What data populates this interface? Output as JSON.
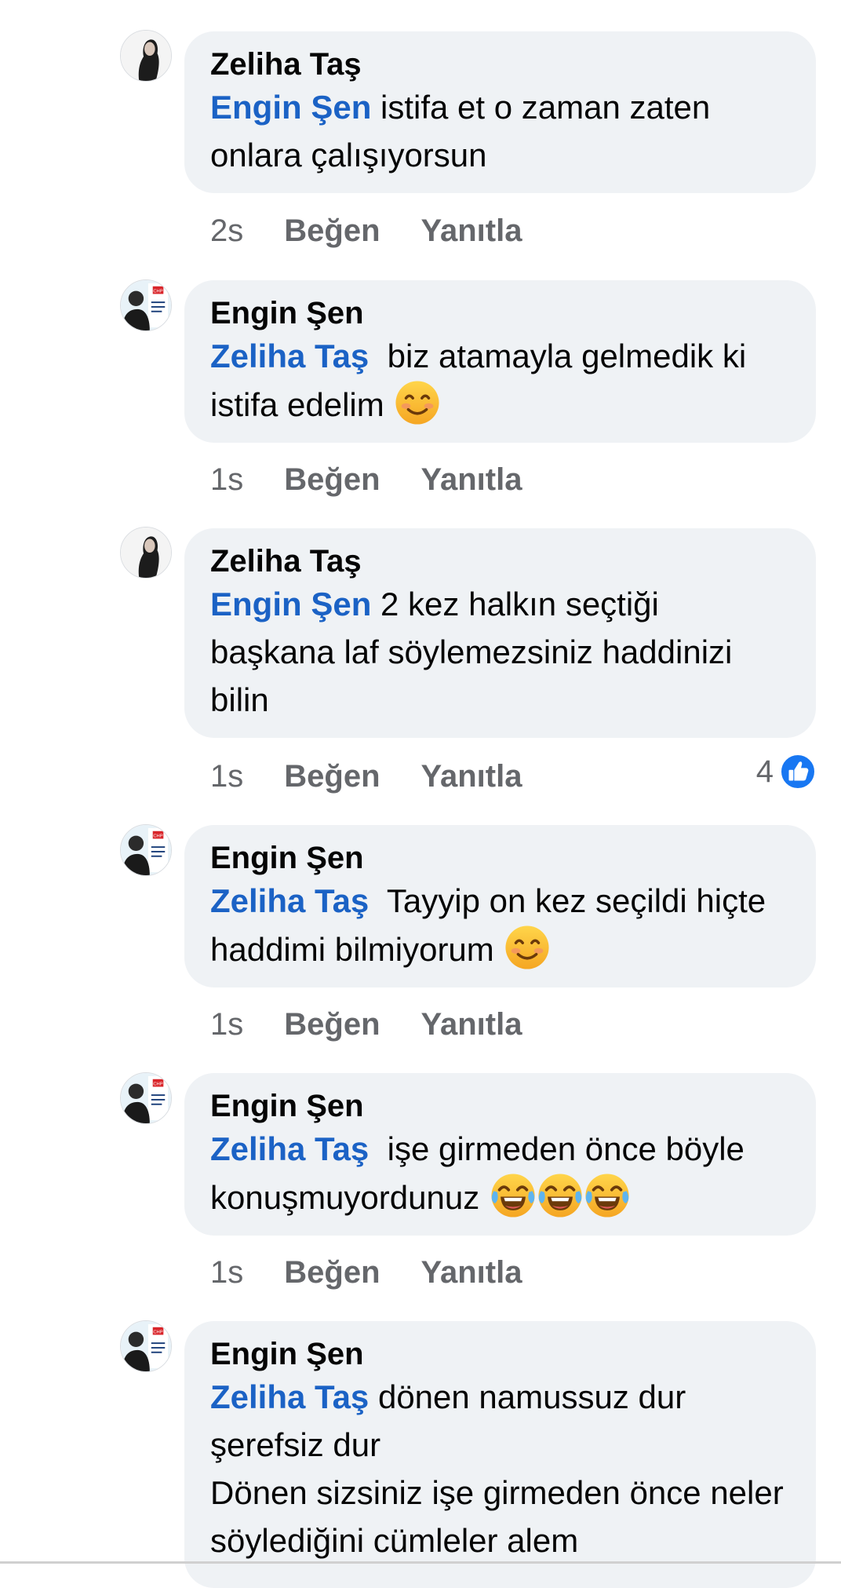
{
  "comments": [
    {
      "author": "Zeliha Taş",
      "mention": "Engin Şen",
      "text": " istifa et o zaman zaten onlara çalışıyorsun",
      "time": "2s",
      "like_label": "Beğen",
      "reply_label": "Yanıtla",
      "avatar_icon": "profile-photo-woman"
    },
    {
      "author": "Engin Şen",
      "mention": "Zeliha Taş",
      "text": "  biz atamayla gelmedik ki istifa edelim",
      "emoji": "smiling-face-icon",
      "time": "1s",
      "like_label": "Beğen",
      "reply_label": "Yanıtla",
      "avatar_icon": "profile-photo-chp"
    },
    {
      "author": "Zeliha Taş",
      "mention": "Engin Şen",
      "text": " 2 kez halkın seçtiği başkana laf söylemezsiniz haddinizi bilin",
      "time": "1s",
      "like_label": "Beğen",
      "reply_label": "Yanıtla",
      "reaction_count": "4",
      "reaction_icon": "like-thumb-icon",
      "avatar_icon": "profile-photo-woman"
    },
    {
      "author": "Engin Şen",
      "mention": "Zeliha Taş",
      "text": "  Tayyip on kez seçildi hiçte haddimi bilmiyorum",
      "emoji": "smiling-face-icon",
      "time": "1s",
      "like_label": "Beğen",
      "reply_label": "Yanıtla",
      "avatar_icon": "profile-photo-chp"
    },
    {
      "author": "Engin Şen",
      "mention": "Zeliha Taş",
      "text": "  işe girmeden önce böyle konuşmuyordunuz",
      "emoji": "tears-of-joy-icon",
      "emoji_count": 3,
      "time": "1s",
      "like_label": "Beğen",
      "reply_label": "Yanıtla",
      "avatar_icon": "profile-photo-chp"
    },
    {
      "author": "Engin Şen",
      "mention": "Zeliha Taş",
      "text": " dönen namussuz dur şerefsiz dur\nDönen sizsiniz işe girmeden önce neler söylediğini cümleler alem",
      "avatar_icon": "profile-photo-chp"
    }
  ],
  "avatar_logo_text": "CHP",
  "colors": {
    "mention": "#1b62c5",
    "bubble": "#eff2f5",
    "meta": "#65676b",
    "like_blue": "#1877f2"
  }
}
